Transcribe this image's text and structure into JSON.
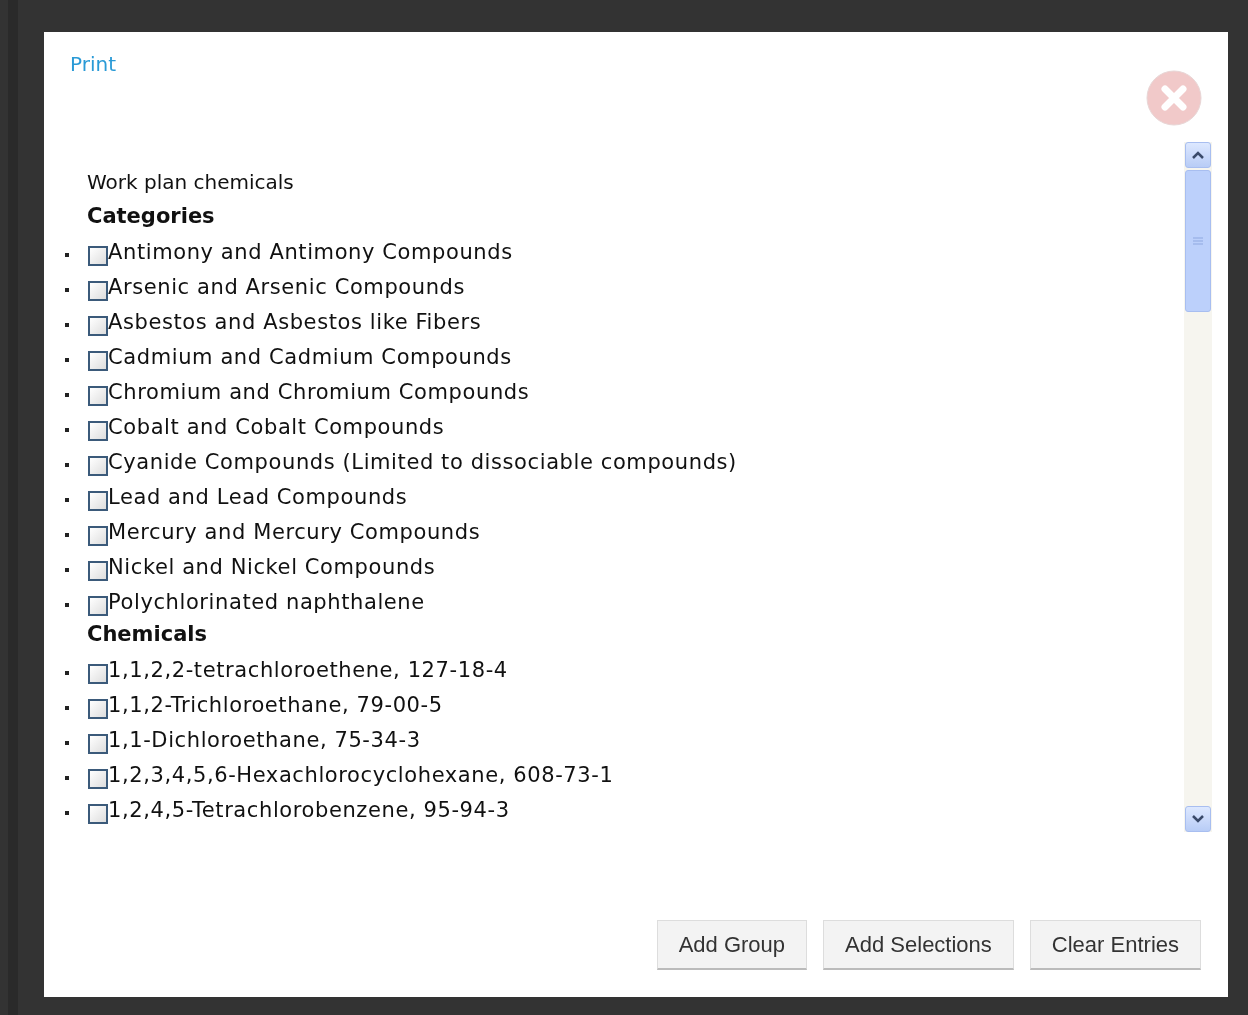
{
  "print_link": "Print",
  "title": "Work plan chemicals",
  "sections": [
    {
      "heading": "Categories",
      "items": [
        {
          "label": "Antimony and Antimony Compounds",
          "checked": false
        },
        {
          "label": "Arsenic and Arsenic Compounds",
          "checked": false
        },
        {
          "label": "Asbestos and Asbestos like Fibers",
          "checked": false
        },
        {
          "label": "Cadmium and Cadmium Compounds",
          "checked": false
        },
        {
          "label": "Chromium and Chromium Compounds",
          "checked": false
        },
        {
          "label": "Cobalt and Cobalt Compounds",
          "checked": false
        },
        {
          "label": "Cyanide Compounds (Limited to dissociable compounds)",
          "checked": false
        },
        {
          "label": "Lead and Lead Compounds",
          "checked": false
        },
        {
          "label": "Mercury and Mercury Compounds",
          "checked": false
        },
        {
          "label": "Nickel and Nickel Compounds",
          "checked": false
        },
        {
          "label": "Polychlorinated naphthalene",
          "checked": false
        }
      ]
    },
    {
      "heading": "Chemicals",
      "items": [
        {
          "label": "1,1,2,2-tetrachloroethene, 127-18-4",
          "checked": false
        },
        {
          "label": "1,1,2-Trichloroethane, 79-00-5",
          "checked": false
        },
        {
          "label": "1,1-Dichloroethane, 75-34-3",
          "checked": false
        },
        {
          "label": "1,2,3,4,5,6-Hexachlorocyclohexane, 608-73-1",
          "checked": false
        },
        {
          "label": "1,2,4,5-Tetrachlorobenzene, 95-94-3",
          "checked": false
        }
      ]
    }
  ],
  "buttons": [
    "Add Group",
    "Add Selections",
    "Clear Entries"
  ]
}
